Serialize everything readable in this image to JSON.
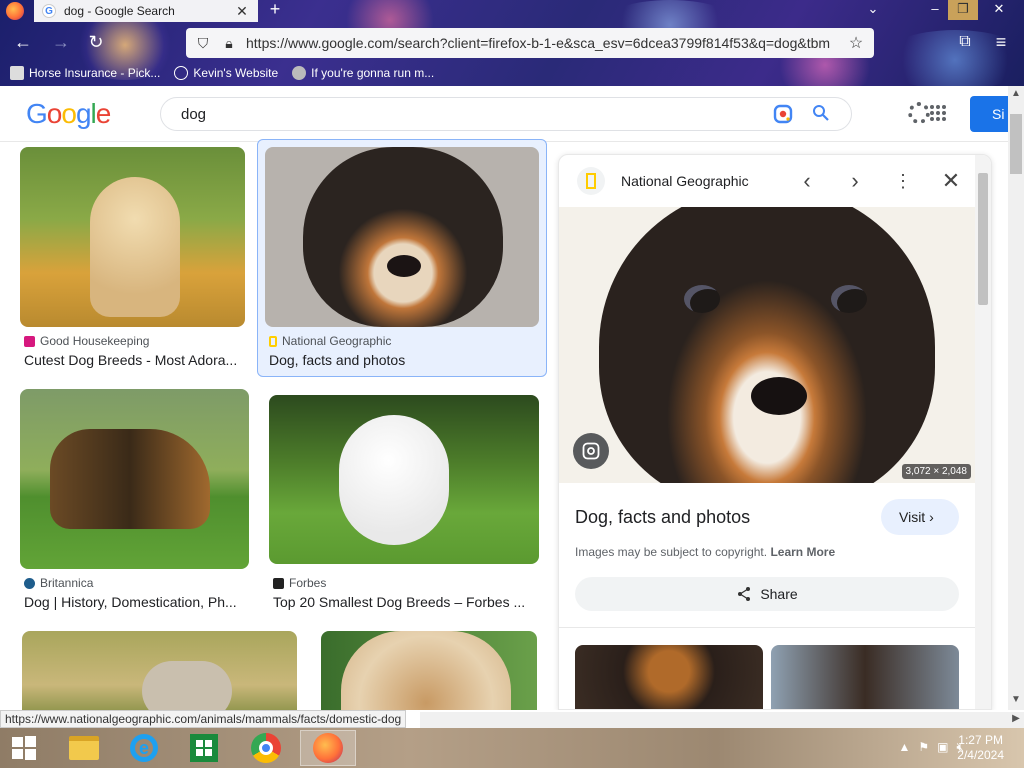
{
  "browser": {
    "tab_title": "dog - Google Search",
    "url": "https://www.google.com/search?client=firefox-b-1-e&sca_esv=6dcea3799f814f53&q=dog&tbm",
    "bookmarks": [
      {
        "label": "Horse Insurance - Pick..."
      },
      {
        "label": "Kevin's Website"
      },
      {
        "label": "If you're gonna run m..."
      }
    ],
    "status_url": "https://www.nationalgeographic.com/animals/mammals/facts/domestic-dog"
  },
  "google": {
    "logo": "Google",
    "query": "dog",
    "signin_label": "Si"
  },
  "results": [
    {
      "source": "Good Housekeeping",
      "title": "Cutest Dog Breeds - Most Adora...",
      "source_color": "#d6187e"
    },
    {
      "source": "National Geographic",
      "title": "Dog, facts and photos",
      "source_color": "#ffce00"
    },
    {
      "source": "Britannica",
      "title": "Dog | History, Domestication, Ph...",
      "source_color": "#1e5d8c"
    },
    {
      "source": "Forbes",
      "title": "Top 20 Smallest Dog Breeds – Forbes ...",
      "source_color": "#222222"
    }
  ],
  "panel": {
    "source": "National Geographic",
    "dimensions": "3,072 × 2,048",
    "title": "Dog, facts and photos",
    "visit_label": "Visit",
    "copyright_text": "Images may be subject to copyright.",
    "learn_more": "Learn More",
    "share_label": "Share"
  },
  "taskbar": {
    "time": "1:27 PM",
    "date": "2/4/2024"
  }
}
